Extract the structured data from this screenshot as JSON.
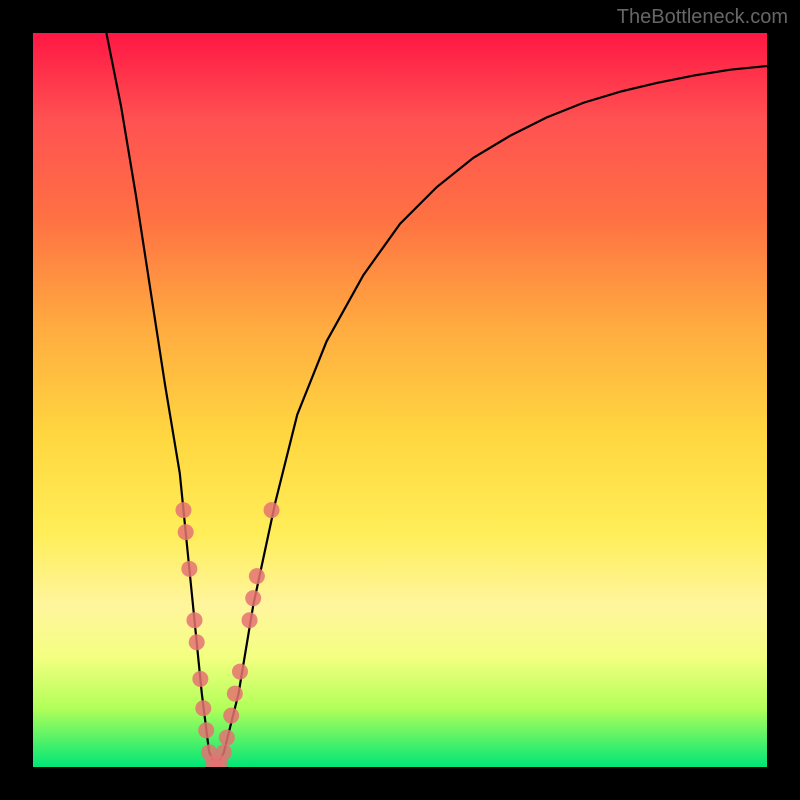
{
  "watermark": "TheBottleneck.com",
  "chart_data": {
    "type": "line",
    "title": "",
    "xlabel": "",
    "ylabel": "",
    "xlim": [
      0,
      100
    ],
    "ylim": [
      0,
      100
    ],
    "curve": {
      "name": "bottleneck-curve",
      "x": [
        10,
        12,
        14,
        16,
        18,
        20,
        21,
        22,
        23,
        24,
        25,
        26,
        28,
        30,
        33,
        36,
        40,
        45,
        50,
        55,
        60,
        65,
        70,
        75,
        80,
        85,
        90,
        95,
        100
      ],
      "y": [
        100,
        90,
        78,
        65,
        52,
        40,
        30,
        20,
        10,
        2,
        0,
        2,
        10,
        22,
        36,
        48,
        58,
        67,
        74,
        79,
        83,
        86,
        88.5,
        90.5,
        92,
        93.2,
        94.2,
        95,
        95.5
      ]
    },
    "markers": {
      "name": "sample-points",
      "color": "#e57272",
      "points": [
        {
          "x": 20.5,
          "y": 35
        },
        {
          "x": 20.8,
          "y": 32
        },
        {
          "x": 21.3,
          "y": 27
        },
        {
          "x": 22.0,
          "y": 20
        },
        {
          "x": 22.3,
          "y": 17
        },
        {
          "x": 22.8,
          "y": 12
        },
        {
          "x": 23.2,
          "y": 8
        },
        {
          "x": 23.6,
          "y": 5
        },
        {
          "x": 24.0,
          "y": 2
        },
        {
          "x": 24.5,
          "y": 0.5
        },
        {
          "x": 25.0,
          "y": 0
        },
        {
          "x": 25.5,
          "y": 0.5
        },
        {
          "x": 26.0,
          "y": 2
        },
        {
          "x": 26.4,
          "y": 4
        },
        {
          "x": 27.0,
          "y": 7
        },
        {
          "x": 27.5,
          "y": 10
        },
        {
          "x": 28.2,
          "y": 13
        },
        {
          "x": 29.5,
          "y": 20
        },
        {
          "x": 30.0,
          "y": 23
        },
        {
          "x": 30.5,
          "y": 26
        },
        {
          "x": 32.5,
          "y": 35
        }
      ]
    }
  }
}
